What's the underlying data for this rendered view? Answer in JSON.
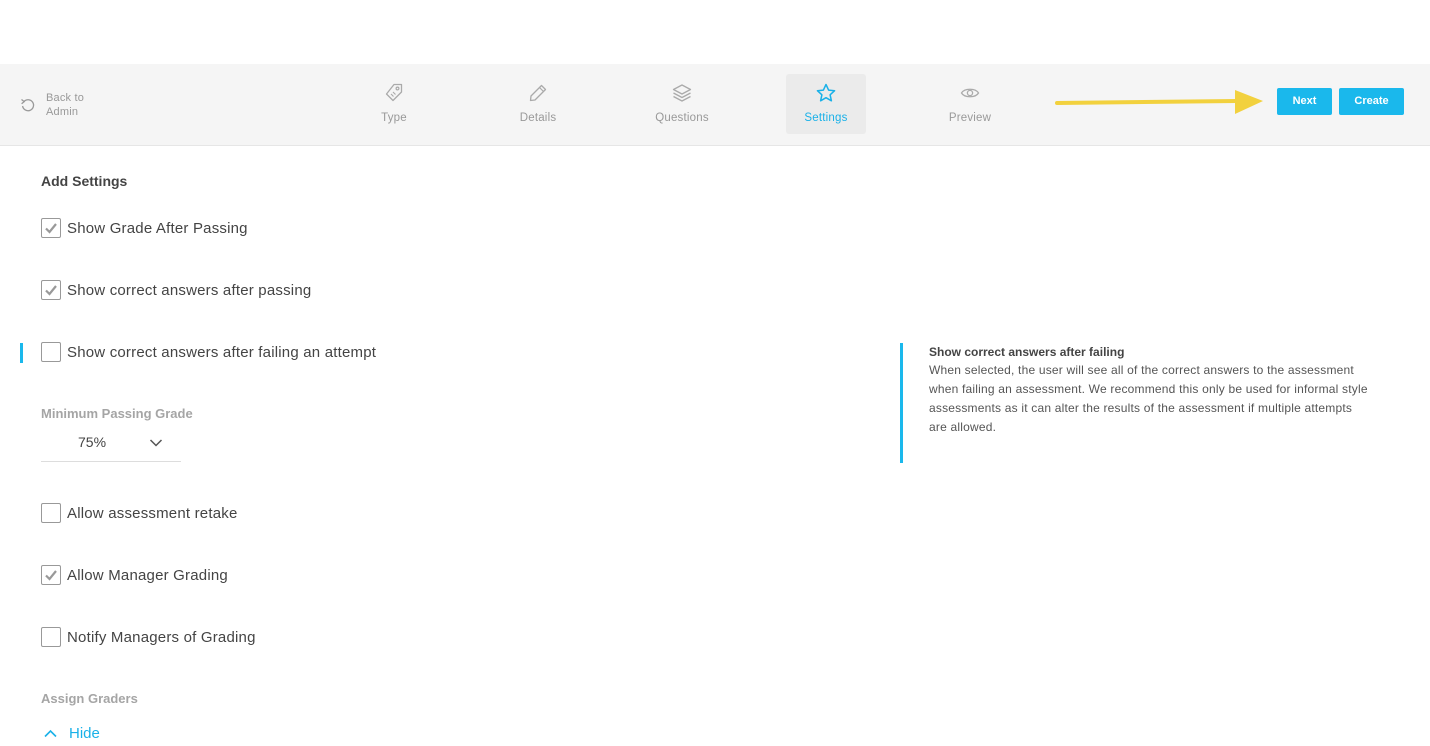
{
  "header": {
    "back_label": "Back to Admin",
    "steps": [
      {
        "label": "Type",
        "icon": "tag-icon"
      },
      {
        "label": "Details",
        "icon": "pencil-icon"
      },
      {
        "label": "Questions",
        "icon": "layers-icon"
      },
      {
        "label": "Settings",
        "icon": "star-icon",
        "active": true
      },
      {
        "label": "Preview",
        "icon": "eye-icon"
      }
    ],
    "next_label": "Next",
    "create_label": "Create"
  },
  "settings": {
    "title": "Add Settings",
    "options": [
      {
        "label": "Show Grade After Passing",
        "checked": true
      },
      {
        "label": "Show correct answers after passing",
        "checked": true
      },
      {
        "label": "Show correct answers after failing an attempt",
        "checked": false
      },
      {
        "label": "Allow assessment retake",
        "checked": false
      },
      {
        "label": "Allow Manager Grading",
        "checked": true
      },
      {
        "label": "Notify Managers of Grading",
        "checked": false
      }
    ],
    "min_grade_label": "Minimum Passing Grade",
    "min_grade_value": "75%",
    "assign_graders_label": "Assign Graders",
    "hide_label": "Hide"
  },
  "info_panel": {
    "title": "Show correct answers after failing",
    "body": "When selected, the user will see all of the correct answers to the assessment when failing an assessment. We recommend this only be used for informal style assessments as it can alter the results of the assessment if multiple attempts are allowed."
  },
  "colors": {
    "accent": "#1ab8ec",
    "annotation_arrow": "#f2d13e"
  }
}
